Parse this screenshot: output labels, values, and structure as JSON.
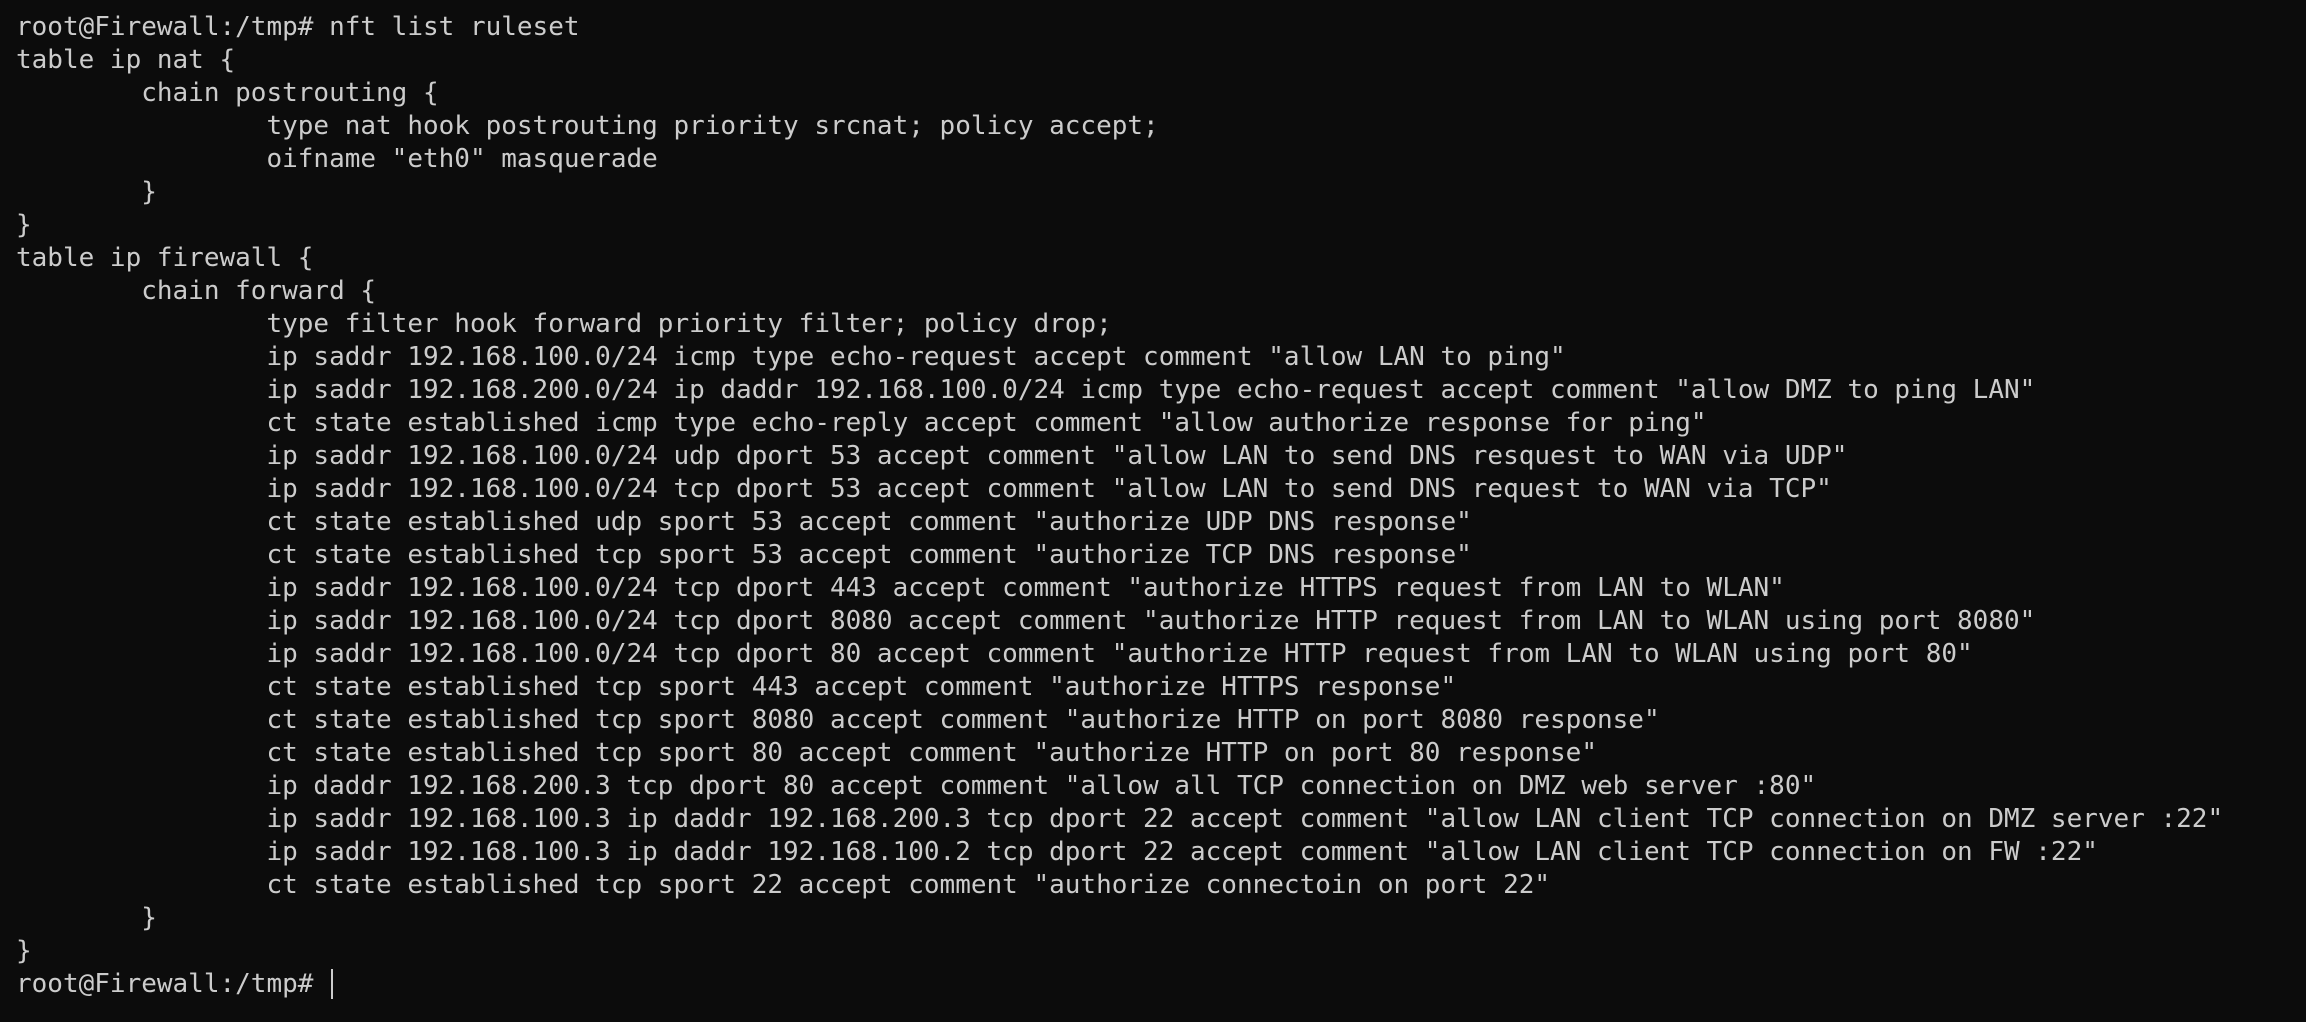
{
  "terminal": {
    "lines": [
      "root@Firewall:/tmp# nft list ruleset",
      "table ip nat {",
      "        chain postrouting {",
      "                type nat hook postrouting priority srcnat; policy accept;",
      "                oifname \"eth0\" masquerade",
      "        }",
      "}",
      "table ip firewall {",
      "        chain forward {",
      "                type filter hook forward priority filter; policy drop;",
      "                ip saddr 192.168.100.0/24 icmp type echo-request accept comment \"allow LAN to ping\"",
      "                ip saddr 192.168.200.0/24 ip daddr 192.168.100.0/24 icmp type echo-request accept comment \"allow DMZ to ping LAN\"",
      "                ct state established icmp type echo-reply accept comment \"allow authorize response for ping\"",
      "                ip saddr 192.168.100.0/24 udp dport 53 accept comment \"allow LAN to send DNS resquest to WAN via UDP\"",
      "                ip saddr 192.168.100.0/24 tcp dport 53 accept comment \"allow LAN to send DNS request to WAN via TCP\"",
      "                ct state established udp sport 53 accept comment \"authorize UDP DNS response\"",
      "                ct state established tcp sport 53 accept comment \"authorize TCP DNS response\"",
      "                ip saddr 192.168.100.0/24 tcp dport 443 accept comment \"authorize HTTPS request from LAN to WLAN\"",
      "                ip saddr 192.168.100.0/24 tcp dport 8080 accept comment \"authorize HTTP request from LAN to WLAN using port 8080\"",
      "                ip saddr 192.168.100.0/24 tcp dport 80 accept comment \"authorize HTTP request from LAN to WLAN using port 80\"",
      "                ct state established tcp sport 443 accept comment \"authorize HTTPS response\"",
      "                ct state established tcp sport 8080 accept comment \"authorize HTTP on port 8080 response\"",
      "                ct state established tcp sport 80 accept comment \"authorize HTTP on port 80 response\"",
      "                ip daddr 192.168.200.3 tcp dport 80 accept comment \"allow all TCP connection on DMZ web server :80\"",
      "                ip saddr 192.168.100.3 ip daddr 192.168.200.3 tcp dport 22 accept comment \"allow LAN client TCP connection on DMZ server :22\"",
      "                ip saddr 192.168.100.3 ip daddr 192.168.100.2 tcp dport 22 accept comment \"allow LAN client TCP connection on FW :22\"",
      "                ct state established tcp sport 22 accept comment \"authorize connectoin on port 22\"",
      "        }",
      "}"
    ],
    "prompt": "root@Firewall:/tmp# ",
    "colors": {
      "background": "#0c0c0c",
      "foreground": "#cccccc"
    }
  }
}
